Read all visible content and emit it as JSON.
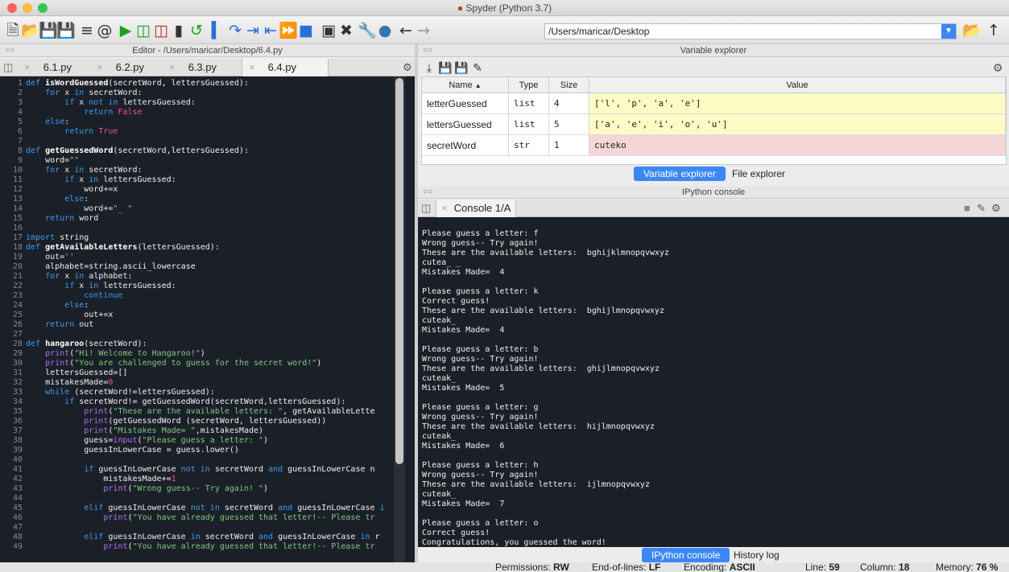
{
  "title": "Spyder (Python 3.7)",
  "path": "/Users/maricar/Desktop",
  "editor": {
    "header": "Editor - /Users/maricar/Desktop/6.4.py",
    "tabs": [
      "6.1.py",
      "6.2.py",
      "6.3.py",
      "6.4.py"
    ],
    "active_tab": "6.4.py"
  },
  "code": [
    {
      "n": "1",
      "t": [
        [
          "kw",
          "def "
        ],
        [
          "fn",
          "isWordGuessed"
        ],
        [
          "",
          "(secretWord, lettersGuessed):"
        ]
      ]
    },
    {
      "n": "2",
      "t": [
        [
          "",
          "    "
        ],
        [
          "kw",
          "for "
        ],
        [
          "",
          "x "
        ],
        [
          "kw",
          "in "
        ],
        [
          "",
          "secretWord:"
        ]
      ]
    },
    {
      "n": "3",
      "t": [
        [
          "",
          "        "
        ],
        [
          "kw",
          "if "
        ],
        [
          "",
          "x "
        ],
        [
          "kw",
          "not in "
        ],
        [
          "",
          "lettersGuessed:"
        ]
      ]
    },
    {
      "n": "4",
      "t": [
        [
          "",
          "            "
        ],
        [
          "kw",
          "return "
        ],
        [
          "num",
          "False"
        ]
      ]
    },
    {
      "n": "5",
      "t": [
        [
          "kw",
          "    else"
        ],
        [
          "",
          ":"
        ]
      ]
    },
    {
      "n": "6",
      "t": [
        [
          "",
          "        "
        ],
        [
          "kw",
          "return "
        ],
        [
          "num",
          "True"
        ]
      ]
    },
    {
      "n": "7",
      "t": []
    },
    {
      "n": "8",
      "t": [
        [
          "kw",
          "def "
        ],
        [
          "fn",
          "getGuessedWord"
        ],
        [
          "",
          "(secretWord,lettersGuessed):"
        ]
      ]
    },
    {
      "n": "9",
      "t": [
        [
          "",
          "    word="
        ],
        [
          "str",
          "\"\""
        ]
      ]
    },
    {
      "n": "10",
      "t": [
        [
          "",
          "    "
        ],
        [
          "kw",
          "for "
        ],
        [
          "",
          "x "
        ],
        [
          "kw",
          "in "
        ],
        [
          "",
          "secretWord:"
        ]
      ]
    },
    {
      "n": "11",
      "t": [
        [
          "",
          "        "
        ],
        [
          "kw",
          "if "
        ],
        [
          "",
          "x "
        ],
        [
          "kw",
          "in "
        ],
        [
          "",
          "lettersGuessed:"
        ]
      ]
    },
    {
      "n": "12",
      "t": [
        [
          "",
          "            word+=x"
        ]
      ]
    },
    {
      "n": "13",
      "t": [
        [
          "kw",
          "        else"
        ],
        [
          "",
          ":"
        ]
      ]
    },
    {
      "n": "14",
      "t": [
        [
          "",
          "            word+="
        ],
        [
          "str",
          "\"_ \""
        ]
      ]
    },
    {
      "n": "15",
      "t": [
        [
          "",
          "    "
        ],
        [
          "kw",
          "return "
        ],
        [
          "",
          "word"
        ]
      ]
    },
    {
      "n": "16",
      "t": []
    },
    {
      "n": "17",
      "t": [
        [
          "kw",
          "import "
        ],
        [
          "",
          "string"
        ]
      ]
    },
    {
      "n": "18",
      "t": [
        [
          "kw",
          "def "
        ],
        [
          "fn",
          "getAvailableLetters"
        ],
        [
          "",
          "(lettersGuessed):"
        ]
      ]
    },
    {
      "n": "19",
      "t": [
        [
          "",
          "    out="
        ],
        [
          "str",
          "''"
        ]
      ]
    },
    {
      "n": "20",
      "t": [
        [
          "",
          "    alphabet=string.ascii_lowercase"
        ]
      ]
    },
    {
      "n": "21",
      "t": [
        [
          "",
          "    "
        ],
        [
          "kw",
          "for "
        ],
        [
          "",
          "x "
        ],
        [
          "kw",
          "in "
        ],
        [
          "",
          "alphabet:"
        ]
      ]
    },
    {
      "n": "22",
      "t": [
        [
          "",
          "        "
        ],
        [
          "kw",
          "if "
        ],
        [
          "",
          "x "
        ],
        [
          "kw",
          "in "
        ],
        [
          "",
          "lettersGuessed:"
        ]
      ]
    },
    {
      "n": "23",
      "t": [
        [
          "kw",
          "            continue"
        ]
      ]
    },
    {
      "n": "24",
      "t": [
        [
          "kw",
          "        else"
        ],
        [
          "",
          ":"
        ]
      ]
    },
    {
      "n": "25",
      "t": [
        [
          "",
          "            out+=x"
        ]
      ]
    },
    {
      "n": "26",
      "t": [
        [
          "",
          "    "
        ],
        [
          "kw",
          "return "
        ],
        [
          "",
          "out"
        ]
      ]
    },
    {
      "n": "27",
      "t": []
    },
    {
      "n": "28",
      "t": [
        [
          "kw",
          "def "
        ],
        [
          "fn",
          "hangaroo"
        ],
        [
          "",
          "(secretWord):"
        ]
      ]
    },
    {
      "n": "29",
      "t": [
        [
          "",
          "    "
        ],
        [
          "pr",
          "print"
        ],
        [
          "",
          "("
        ],
        [
          "str",
          "\"Hi! Welcome to Hangaroo!\""
        ],
        [
          "",
          ")"
        ]
      ]
    },
    {
      "n": "30",
      "t": [
        [
          "",
          "    "
        ],
        [
          "pr",
          "print"
        ],
        [
          "",
          "("
        ],
        [
          "str",
          "\"You are challenged to guess for the secret word!\""
        ],
        [
          "",
          ")"
        ]
      ]
    },
    {
      "n": "31",
      "t": [
        [
          "",
          "    lettersGuessed=[]"
        ]
      ]
    },
    {
      "n": "32",
      "t": [
        [
          "",
          "    mistakesMade="
        ],
        [
          "num",
          "0"
        ]
      ]
    },
    {
      "n": "33",
      "t": [
        [
          "",
          "    "
        ],
        [
          "kw",
          "while "
        ],
        [
          "",
          "(secretWord!=lettersGuessed):"
        ]
      ]
    },
    {
      "n": "34",
      "t": [
        [
          "",
          "        "
        ],
        [
          "kw",
          "if "
        ],
        [
          "",
          "secretWord!= getGuessedWord(secretWord,lettersGuessed):"
        ]
      ]
    },
    {
      "n": "35",
      "t": [
        [
          "",
          "            "
        ],
        [
          "pr",
          "print"
        ],
        [
          "",
          "("
        ],
        [
          "str",
          "\"These are the available letters: \""
        ],
        [
          "",
          ", getAvailableLette"
        ]
      ]
    },
    {
      "n": "36",
      "t": [
        [
          "",
          "            "
        ],
        [
          "pr",
          "print"
        ],
        [
          "",
          "(getGuessedWord (secretWord, lettersGuessed))"
        ]
      ]
    },
    {
      "n": "37",
      "t": [
        [
          "",
          "            "
        ],
        [
          "pr",
          "print"
        ],
        [
          "",
          "("
        ],
        [
          "str",
          "\"Mistakes Made= \""
        ],
        [
          "",
          ",mistakesMade)"
        ]
      ]
    },
    {
      "n": "38",
      "t": [
        [
          "",
          "            guess="
        ],
        [
          "pr",
          "input"
        ],
        [
          "",
          "("
        ],
        [
          "str",
          "\"Please guess a letter: \""
        ],
        [
          "",
          ")"
        ]
      ]
    },
    {
      "n": "39",
      "t": [
        [
          "",
          "            guessInLowerCase = guess.lower()"
        ]
      ]
    },
    {
      "n": "40",
      "t": []
    },
    {
      "n": "41",
      "t": [
        [
          "",
          "            "
        ],
        [
          "kw",
          "if "
        ],
        [
          "",
          "guessInLowerCase "
        ],
        [
          "kw",
          "not in "
        ],
        [
          "",
          "secretWord "
        ],
        [
          "kw",
          "and "
        ],
        [
          "",
          "guessInLowerCase n"
        ]
      ]
    },
    {
      "n": "42",
      "t": [
        [
          "",
          "                mistakesMade+="
        ],
        [
          "num",
          "1"
        ]
      ]
    },
    {
      "n": "43",
      "t": [
        [
          "",
          "                "
        ],
        [
          "pr",
          "print"
        ],
        [
          "",
          "("
        ],
        [
          "str",
          "\"Wrong guess-- Try again! \""
        ],
        [
          "",
          ")"
        ]
      ]
    },
    {
      "n": "44",
      "t": []
    },
    {
      "n": "45",
      "t": [
        [
          "",
          "            "
        ],
        [
          "kw",
          "elif "
        ],
        [
          "",
          "guessInLowerCase "
        ],
        [
          "kw",
          "not in "
        ],
        [
          "",
          "secretWord "
        ],
        [
          "kw",
          "and "
        ],
        [
          "",
          "guessInLowerCase "
        ],
        [
          "kw",
          "i"
        ]
      ]
    },
    {
      "n": "46",
      "t": [
        [
          "",
          "                "
        ],
        [
          "pr",
          "print"
        ],
        [
          "",
          "("
        ],
        [
          "str",
          "\"You have already guessed that letter!-- Please tr"
        ]
      ]
    },
    {
      "n": "47",
      "t": []
    },
    {
      "n": "48",
      "t": [
        [
          "",
          "            "
        ],
        [
          "kw",
          "elif "
        ],
        [
          "",
          "guessInLowerCase "
        ],
        [
          "kw",
          "in "
        ],
        [
          "",
          "secretWord "
        ],
        [
          "kw",
          "and "
        ],
        [
          "",
          "guessInLowerCase "
        ],
        [
          "kw",
          "in "
        ],
        [
          "",
          "r"
        ]
      ]
    },
    {
      "n": "49",
      "t": [
        [
          "",
          "                "
        ],
        [
          "pr",
          "print"
        ],
        [
          "",
          "("
        ],
        [
          "str",
          "\"You have already guessed that letter!-- Please tr"
        ]
      ]
    }
  ],
  "varexp": {
    "header": "Variable explorer",
    "columns": [
      "Name",
      "Type",
      "Size",
      "Value"
    ],
    "rows": [
      {
        "name": "letterGuessed",
        "type": "list",
        "size": "4",
        "value": "['l', 'p', 'a', 'e']",
        "color": "#fdfcc4"
      },
      {
        "name": "lettersGuessed",
        "type": "list",
        "size": "5",
        "value": "['a', 'e', 'i', 'o', 'u']",
        "color": "#fdfcc4"
      },
      {
        "name": "secretWord",
        "type": "str",
        "size": "1",
        "value": "cuteko",
        "color": "#f4d6d6"
      }
    ],
    "tabs": [
      "Variable explorer",
      "File explorer"
    ]
  },
  "console": {
    "header": "IPython console",
    "tab": "Console 1/A",
    "lines": [
      "",
      "Please guess a letter: f",
      "Wrong guess-- Try again!",
      "These are the available letters:  bghijklmnopqvwxyz",
      "cutea_ _",
      "Mistakes Made=  4",
      "",
      "Please guess a letter: k",
      "Correct guess!",
      "These are the available letters:  bghijlmnopqvwxyz",
      "cuteak_",
      "Mistakes Made=  4",
      "",
      "Please guess a letter: b",
      "Wrong guess-- Try again!",
      "These are the available letters:  ghijlmnopqvwxyz",
      "cuteak_",
      "Mistakes Made=  5",
      "",
      "Please guess a letter: g",
      "Wrong guess-- Try again!",
      "These are the available letters:  hijlmnopqvwxyz",
      "cuteak_",
      "Mistakes Made=  6",
      "",
      "Please guess a letter: h",
      "Wrong guess-- Try again!",
      "These are the available letters:  ijlmnopqvwxyz",
      "cuteak_",
      "Mistakes Made=  7",
      "",
      "Please guess a letter: o",
      "Correct guess!",
      "Congratulations, you guessed the word!"
    ],
    "bottom_tabs": [
      "IPython console",
      "History log"
    ]
  },
  "status": {
    "perm_label": "Permissions:",
    "perm": "RW",
    "eol_label": "End-of-lines:",
    "eol": "LF",
    "enc_label": "Encoding:",
    "enc": "ASCII",
    "line_label": "Line:",
    "line": "59",
    "col_label": "Column:",
    "col": "18",
    "mem_label": "Memory:",
    "mem": "76 %"
  },
  "colors": {
    "accent": "#3b87f5",
    "editor_bg": "#1b2028"
  }
}
